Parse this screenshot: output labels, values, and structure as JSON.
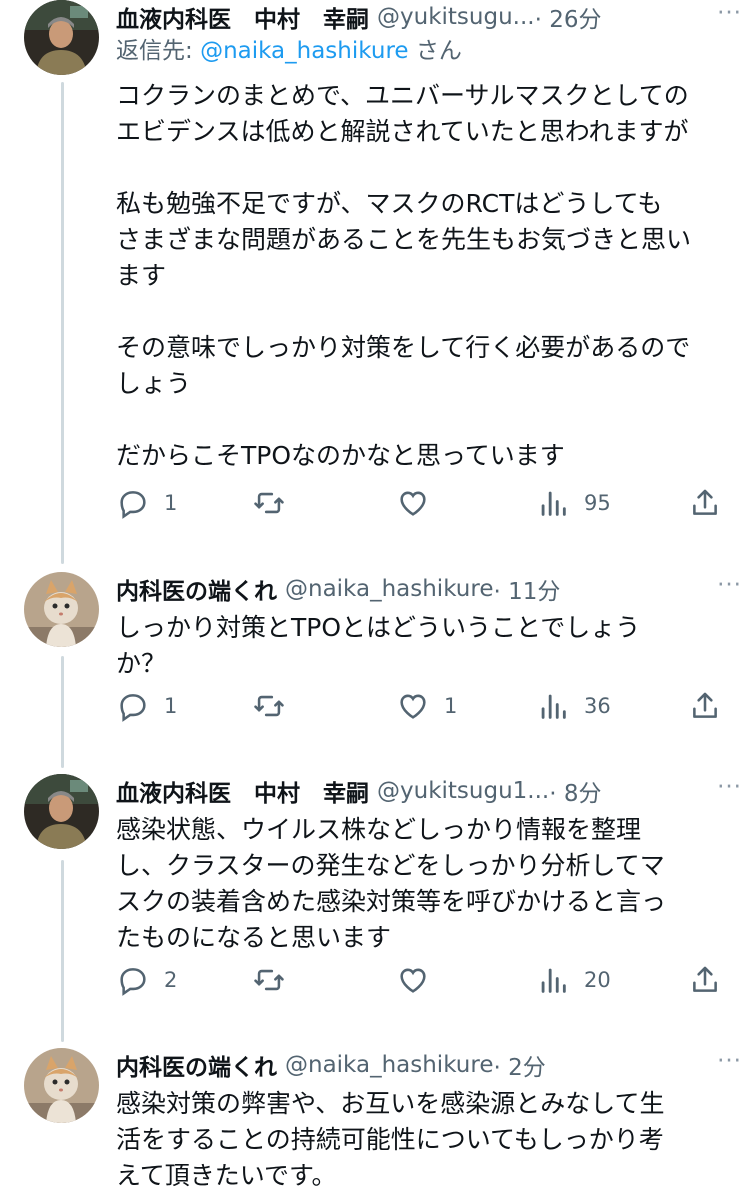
{
  "tweets": [
    {
      "name": "血液内科医　中村　幸嗣",
      "handle": "@yukitsugu...",
      "time": "· 26分",
      "reply_prefix": "返信先: ",
      "reply_mention": "@naika_hashikure",
      "reply_suffix": " さん",
      "text": "コクランのまとめで、ユニバーサルマスクとしての\nエビデンスは低めと解説されていたと思われますが\n\n私も勉強不足ですが、マスクのRCTはどうしても\nさまざまな問題があることを先生もお気づきと思い\nます\n\nその意味でしっかり対策をして行く必要があるので\nしょう\n\nだからこそTPOなのかなと思っています",
      "replies": "1",
      "retweets": "",
      "likes": "",
      "views": "95",
      "avatar": "doctor"
    },
    {
      "name": "内科医の端くれ",
      "handle": "@naika_hashikure",
      "time": "· 11分",
      "text": "しっかり対策とTPOとはどういうことでしょう\nか？",
      "replies": "1",
      "retweets": "",
      "likes": "1",
      "views": "36",
      "avatar": "cat"
    },
    {
      "name": "血液内科医　中村　幸嗣",
      "handle": "@yukitsugu1...",
      "time": "· 8分",
      "text": "感染状態、ウイルス株などしっかり情報を整理\nし、クラスターの発生などをしっかり分析してマ\nスクの装着含めた感染対策等を呼びかけると言っ\nたものになると思います",
      "replies": "2",
      "retweets": "",
      "likes": "",
      "views": "20",
      "avatar": "doctor"
    },
    {
      "name": "内科医の端くれ",
      "handle": "@naika_hashikure",
      "time": "· 2分",
      "text": "感染対策の弊害や、お互いを感染源とみなして生\n活をすることの持続可能性についてもしっかり考\nえて頂きたいです。",
      "avatar": "cat"
    }
  ],
  "more_label": "···",
  "icons": {
    "reply": "reply-icon",
    "retweet": "retweet-icon",
    "like": "like-icon",
    "views": "views-icon",
    "share": "share-icon"
  },
  "colors": {
    "text": "#0f1419",
    "secondary": "#536471",
    "link": "#1d9bf0",
    "thread_line": "#cfd9de"
  }
}
